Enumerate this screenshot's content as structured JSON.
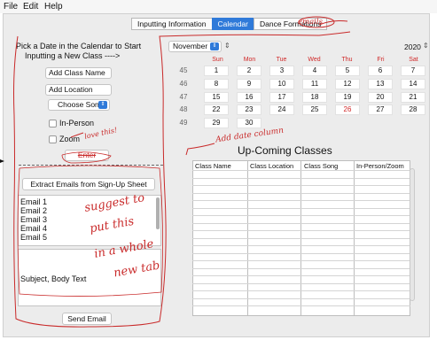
{
  "menu": [
    "File",
    "Edit",
    "Help"
  ],
  "tabs": [
    "Inputting Information",
    "Calendar",
    "Dance Formations",
    "emails"
  ],
  "left": {
    "pick_text": "Pick a Date in the Calendar to Start",
    "inputting_text": "Inputting a New Class ---->",
    "add_class_name": "Add Class Name",
    "add_location": "Add Location",
    "choose_song": "Choose Song",
    "in_person": "In-Person",
    "zoom": "Zoom",
    "enter": "Enter",
    "extract_emails": "Extract Emails from Sign-Up Sheet",
    "emails": [
      "Email 1",
      "Email 2",
      "Email 3",
      "Email 4",
      "Email 5"
    ],
    "subject_body": "Subject, Body Text",
    "send_email": "Send Email"
  },
  "calendar": {
    "month": "November",
    "year": "2020",
    "days": [
      "Sun",
      "Mon",
      "Tue",
      "Wed",
      "Thu",
      "Fri",
      "Sat"
    ],
    "weeks": [
      {
        "num": "45",
        "dates": [
          "",
          "1",
          "2",
          "3",
          "4",
          "5",
          "6",
          "7"
        ]
      },
      {
        "num": "46",
        "dates": [
          "",
          "8",
          "9",
          "10",
          "11",
          "12",
          "13",
          "14"
        ]
      },
      {
        "num": "47",
        "dates": [
          "",
          "15",
          "16",
          "17",
          "18",
          "19",
          "20",
          "21"
        ]
      },
      {
        "num": "48",
        "dates": [
          "",
          "22",
          "23",
          "24",
          "25",
          "26",
          "27",
          "28"
        ]
      },
      {
        "num": "49",
        "dates": [
          "",
          "29",
          "30",
          "",
          "",
          "",
          "",
          ""
        ]
      }
    ],
    "highlighted_date": "26"
  },
  "table": {
    "title": "Up-Coming Classes",
    "columns": [
      "Class Name",
      "Class Location",
      "Class Song",
      "In-Person/Zoom"
    ]
  },
  "annotations": {
    "love_this": "love this!",
    "add_date_column": "Add date column",
    "suggest": [
      "suggest to",
      "put this",
      "in a whole",
      "new tab"
    ]
  },
  "colors": {
    "accent": "#2f7ad9",
    "annotation": "#c92a2a"
  }
}
